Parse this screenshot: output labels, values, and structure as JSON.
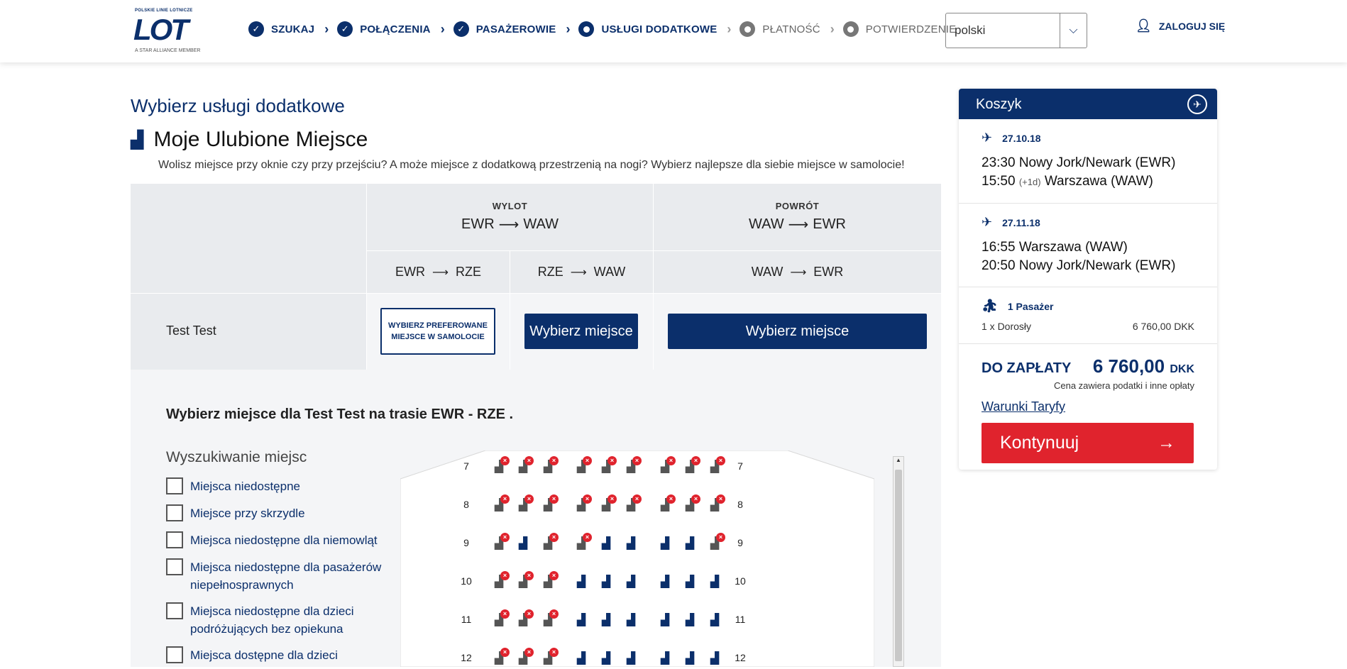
{
  "brand": {
    "top": "POLSKIE LINIE LOTNICZE",
    "name": "LOT",
    "member": "A STAR ALLIANCE MEMBER"
  },
  "steps": [
    {
      "label": "SZUKAJ",
      "state": "done"
    },
    {
      "label": "POŁĄCZENIA",
      "state": "done"
    },
    {
      "label": "PASAŻEROWIE",
      "state": "done"
    },
    {
      "label": "USŁUGI DODATKOWE",
      "state": "current"
    },
    {
      "label": "PŁATNOŚĆ",
      "state": "todo"
    },
    {
      "label": "POTWIERDZENIE",
      "state": "todo"
    }
  ],
  "language": {
    "value": "polski"
  },
  "login": {
    "label": "ZALOGUJ SIĘ"
  },
  "page": {
    "title": "Wybierz usługi dodatkowe",
    "section_title": "Moje Ulubione Miejsce",
    "description": "Wolisz miejsce przy oknie czy przy przejściu? A może miejsce z dodatkową przestrzenią na nogi? Wybierz najlepsze dla siebie miejsce w samolocie!"
  },
  "grid": {
    "outbound": {
      "label": "WYLOT",
      "from": "EWR",
      "to": "WAW"
    },
    "return": {
      "label": "POWRÓT",
      "from": "WAW",
      "to": "EWR"
    },
    "legs": [
      {
        "from": "EWR",
        "to": "RZE"
      },
      {
        "from": "RZE",
        "to": "WAW"
      },
      {
        "from": "WAW",
        "to": "EWR"
      }
    ],
    "passenger": "Test Test",
    "btn_preferred": "WYBIERZ PREFEROWANE MIEJSCE W SAMOLOCIE",
    "btn_select_1": "Wybierz miejsce",
    "btn_select_2": "Wybierz miejsce"
  },
  "seatmap": {
    "heading": "Wybierz miejsce dla Test Test na trasie EWR - RZE .",
    "filters_title": "Wyszukiwanie miejsc",
    "filters": [
      "Miejsca niedostępne",
      "Miejsce przy skrzydle",
      "Miejsca niedostępne dla niemowląt",
      "Miejsca niedostępne dla pasażerów niepełnosprawnych",
      "Miejsca niedostępne dla dzieci podróżujących bez opiekuna",
      "Miejsca dostępne dla dzieci"
    ],
    "rows": [
      {
        "num": "7",
        "seats": [
          0,
          0,
          0,
          0,
          0,
          0,
          0,
          0,
          0
        ]
      },
      {
        "num": "8",
        "seats": [
          0,
          0,
          0,
          0,
          0,
          0,
          0,
          0,
          0
        ]
      },
      {
        "num": "9",
        "seats": [
          0,
          1,
          0,
          0,
          1,
          1,
          1,
          1,
          0
        ]
      },
      {
        "num": "10",
        "seats": [
          0,
          0,
          0,
          1,
          1,
          1,
          1,
          1,
          1
        ]
      },
      {
        "num": "11",
        "seats": [
          0,
          0,
          0,
          1,
          1,
          1,
          1,
          1,
          1
        ]
      },
      {
        "num": "12",
        "seats": [
          0,
          0,
          0,
          1,
          1,
          1,
          1,
          1,
          1
        ]
      }
    ]
  },
  "cart": {
    "title": "Koszyk",
    "flights": [
      {
        "date": "27.10.18",
        "dep": "23:30 Nowy Jork/Newark (EWR)",
        "arr_time": "15:50",
        "arr_plus": "(+1d)",
        "arr_city": "Warszawa (WAW)"
      },
      {
        "date": "27.11.18",
        "dep": "16:55 Warszawa (WAW)",
        "arr_time": "20:50",
        "arr_plus": "",
        "arr_city": "Nowy Jork/Newark (EWR)"
      }
    ],
    "pax_head": "1 Pasażer",
    "pax_type": "1 x Dorosły",
    "pax_price": "6 760,00 DKK",
    "total_label": "DO ZAPŁATY",
    "total_amount": "6 760,00",
    "total_currency": "DKK",
    "tax_note": "Cena zawiera podatki i inne opłaty",
    "fare_link": "Warunki Taryfy",
    "continue": "Kontynuuj"
  },
  "colors": {
    "brand": "#0b2f6b",
    "accent": "#e0232d"
  }
}
